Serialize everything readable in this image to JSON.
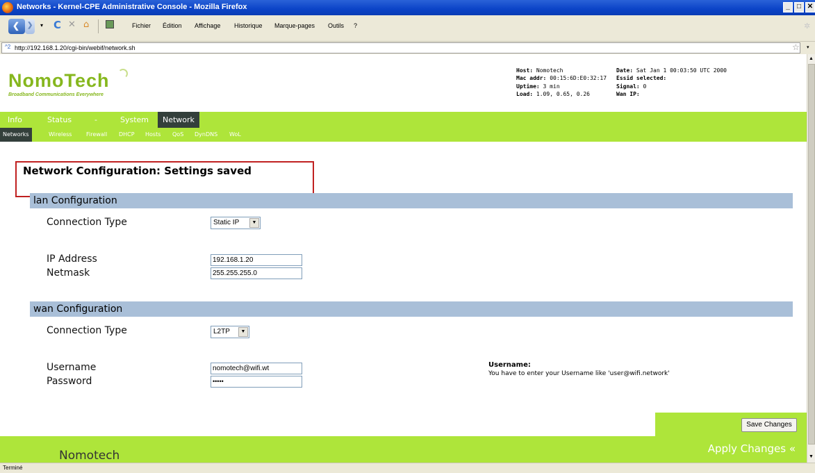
{
  "window": {
    "title": "Networks - Kernel-CPE Administrative Console - Mozilla Firefox"
  },
  "menu": [
    "Fichier",
    "Édition",
    "Affichage",
    "Historique",
    "Marque-pages",
    "Outils",
    "?"
  ],
  "url_bar": {
    "site_label": "^2",
    "url": "http://192.168.1.20/cgi-bin/webif/network.sh"
  },
  "header": {
    "logo_text": "NomoTech",
    "logo_tagline": "Broadband Communications Everywhere",
    "host": {
      "label": "Host:",
      "value": "Nomotech"
    },
    "mac": {
      "label": "Mac addr:",
      "value": "00:15:6D:E0:32:17"
    },
    "uptime": {
      "label": "Uptime:",
      "value": "3 min"
    },
    "load": {
      "label": "Load:",
      "value": "1.09, 0.65, 0.26"
    },
    "date": {
      "label": "Date:",
      "value": "Sat Jan 1 00:03:50 UTC 2000"
    },
    "essid": {
      "label": "Essid selected:",
      "value": ""
    },
    "signal": {
      "label": "Signal:",
      "value": "0"
    },
    "wanip": {
      "label": "Wan IP:",
      "value": ""
    }
  },
  "main_nav": [
    "Info",
    "Status",
    "-",
    "System",
    "Network"
  ],
  "main_nav_active": "Network",
  "sub_nav": [
    "Networks",
    "Wireless",
    "Firewall",
    "DHCP",
    "Hosts",
    "QoS",
    "DynDNS",
    "WoL"
  ],
  "sub_nav_active": "Networks",
  "page_title": "Network Configuration: Settings saved",
  "lan": {
    "title": "lan Configuration",
    "connection_type_label": "Connection Type",
    "connection_type_value": "Static IP",
    "ip_label": "IP Address",
    "ip_value": "192.168.1.20",
    "netmask_label": "Netmask",
    "netmask_value": "255.255.255.0"
  },
  "wan": {
    "title": "wan Configuration",
    "connection_type_label": "Connection Type",
    "connection_type_value": "L2TP",
    "username_label": "Username",
    "username_value": "nomotech@wifi.wt",
    "password_label": "Password",
    "password_value": "•••••",
    "help_title": "Username:",
    "help_text": "You have to enter your Username like 'user@wifi.network'"
  },
  "save_button": "Save Changes",
  "footer": {
    "name": "Nomotech",
    "apply": "Apply Changes «"
  },
  "status_bar": "Terminé",
  "colors": {
    "accent_green": "#aee53a",
    "section_bar": "#a9bfd8",
    "nav_active": "#333f3b",
    "highlight_box": "#c02020"
  }
}
